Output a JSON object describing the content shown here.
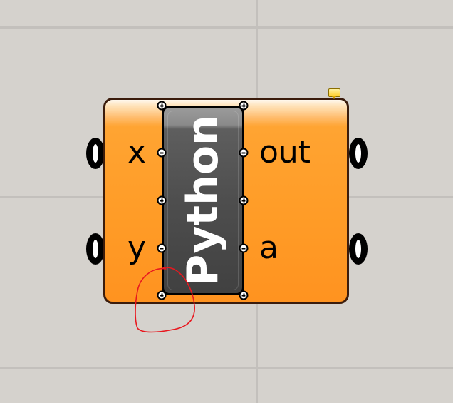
{
  "canvas": {
    "background_color": "#d5d2cd",
    "grid_color": "#c3c0bc"
  },
  "component": {
    "name": "Python",
    "body_color": "#ffa432",
    "inputs": [
      {
        "label": "x"
      },
      {
        "label": "y"
      }
    ],
    "outputs": [
      {
        "label": "out"
      },
      {
        "label": "a"
      }
    ],
    "message_icon": "message-balloon-icon"
  },
  "annotation": {
    "type": "freehand-circle",
    "color": "#e8181f"
  }
}
